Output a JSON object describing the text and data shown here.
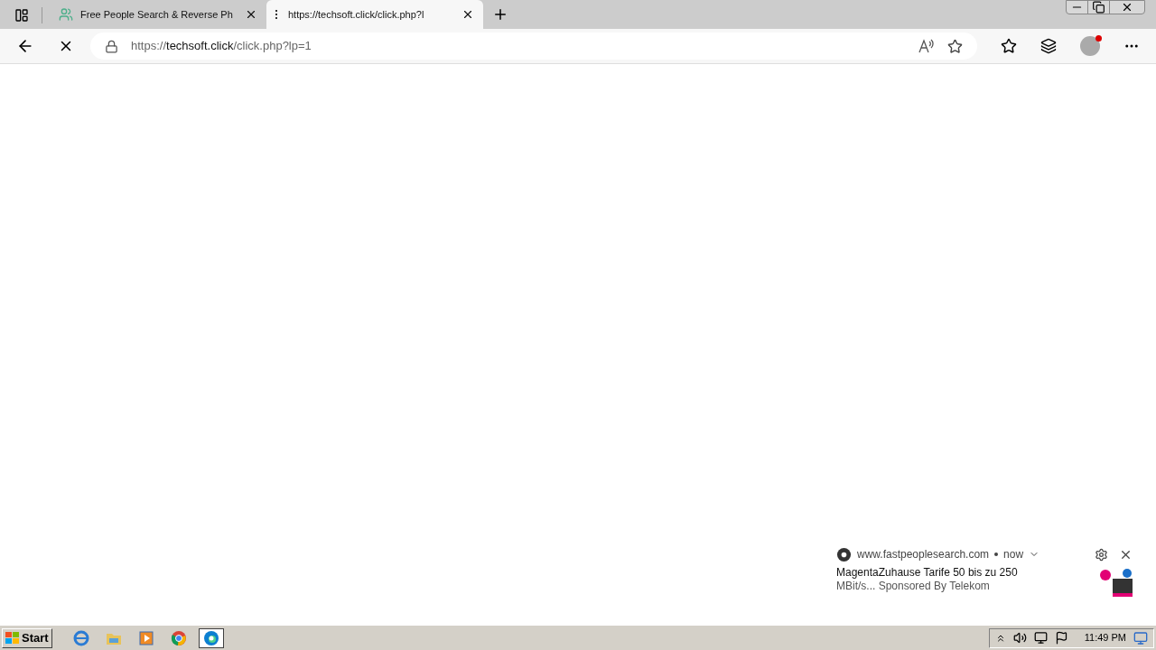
{
  "tabs": [
    {
      "title": "Free People Search & Reverse Ph",
      "selected": false,
      "kind": "people"
    },
    {
      "title": "https://techsoft.click/click.php?l",
      "selected": true,
      "kind": "loading"
    }
  ],
  "address": {
    "scheme": "https://",
    "host": "techsoft.click",
    "path": "/click.php?lp=1"
  },
  "notification": {
    "source": "www.fastpeoplesearch.com",
    "time": "now",
    "title": "MagentaZuhause Tarife 50 bis zu 250",
    "body": "MBit/s... Sponsored By Telekom"
  },
  "taskbar": {
    "start": "Start",
    "apps": [
      {
        "kind": "ie",
        "selected": false
      },
      {
        "kind": "folder",
        "selected": false
      },
      {
        "kind": "media",
        "selected": false
      },
      {
        "kind": "chrome",
        "selected": false
      },
      {
        "kind": "edge",
        "selected": true
      }
    ],
    "clock": "11:49 PM"
  }
}
